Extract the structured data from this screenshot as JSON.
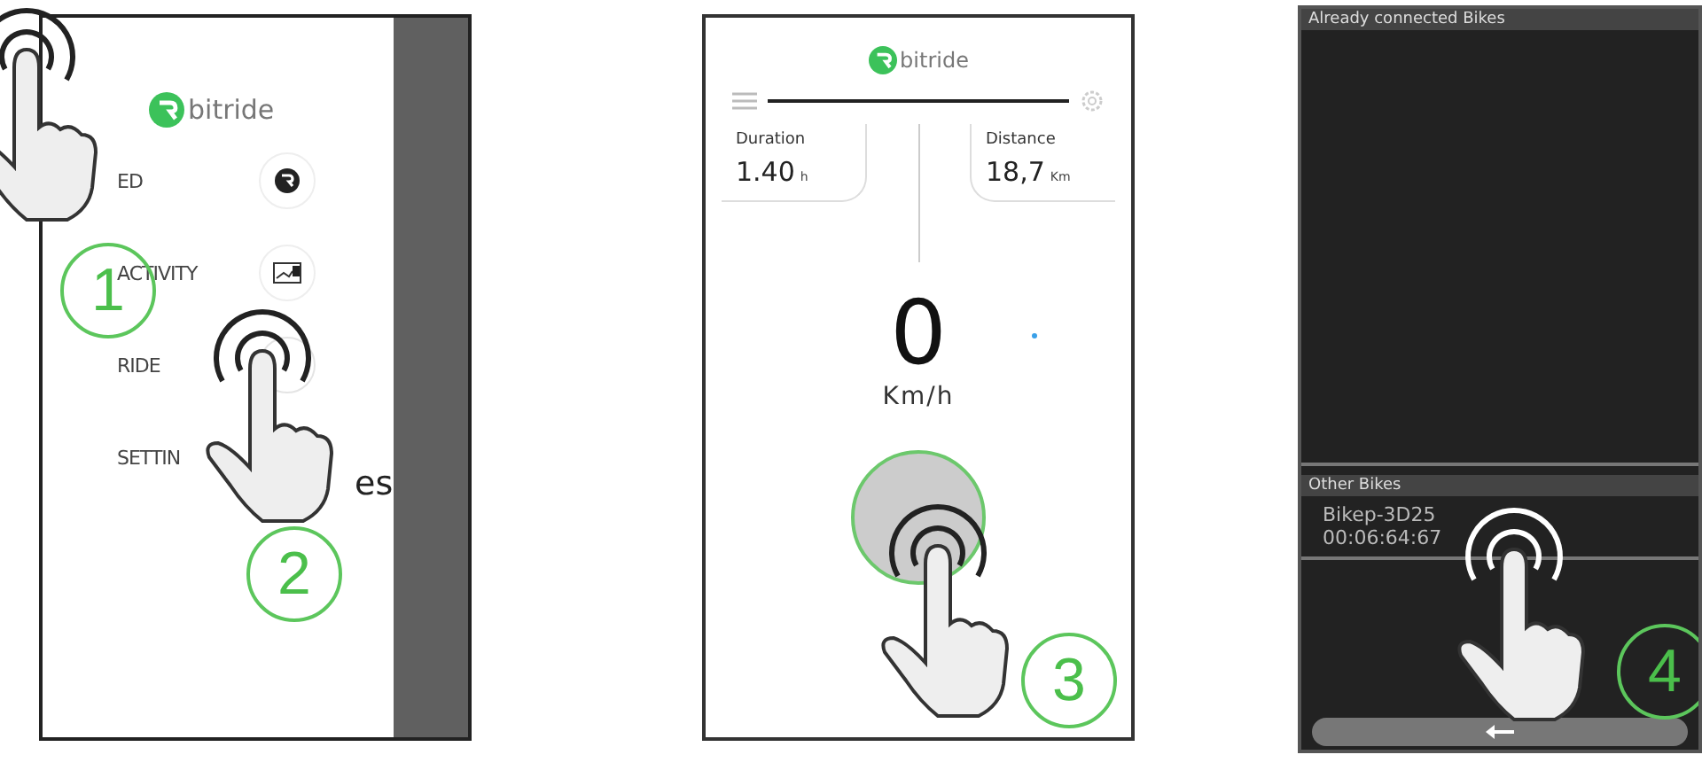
{
  "panels": [
    {
      "kind": "menu",
      "logo": "bitride",
      "items": [
        {
          "label": "ED"
        },
        {
          "label": "ACTIVITY"
        },
        {
          "label": "RIDE"
        },
        {
          "label": "SETTIN"
        }
      ],
      "side_text": "es",
      "steps": [
        "1",
        "2"
      ]
    },
    {
      "kind": "dashboard",
      "logo": "bitride",
      "duration": {
        "label": "Duration",
        "value": "1.40",
        "unit": "h"
      },
      "distance": {
        "label": "Distance",
        "value": "18,7",
        "unit": "Km"
      },
      "speed": "0",
      "speed_unit": "Km/h",
      "steps": [
        "3"
      ]
    },
    {
      "kind": "bike-list",
      "connected_header": "Already connected Bikes",
      "other_header": "Other Bikes",
      "bikes": [
        {
          "name": "Bikep-3D25",
          "address": "00:06:64:67"
        }
      ],
      "steps": [
        "4"
      ]
    }
  ]
}
